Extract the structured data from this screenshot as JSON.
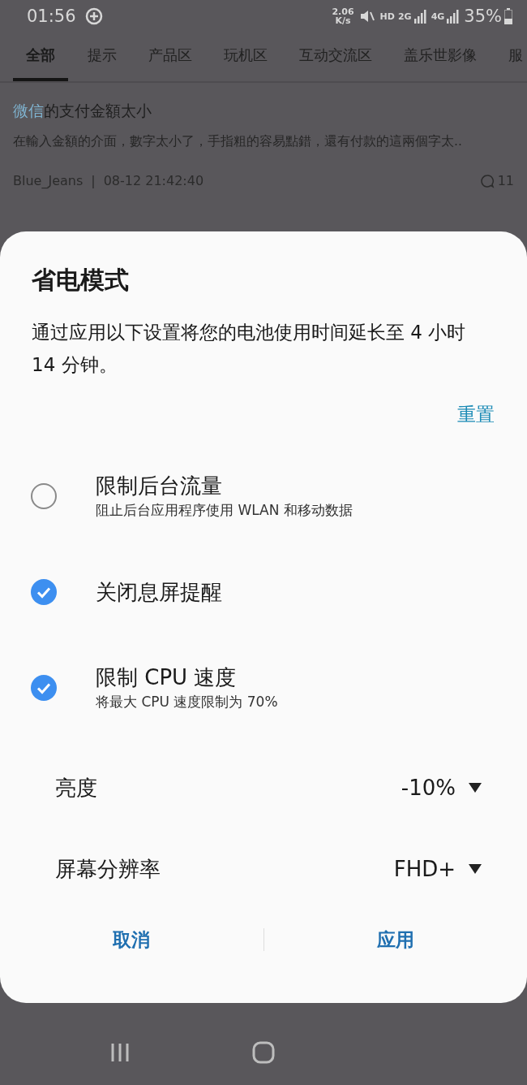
{
  "status_bar": {
    "time": "01:56",
    "net_speed": "2.06",
    "net_unit": "K/s",
    "hd": "HD",
    "sim1": "2G",
    "sim2": "4G",
    "battery": "35%"
  },
  "tabs": [
    {
      "label": "全部",
      "selected": true
    },
    {
      "label": "提示",
      "selected": false
    },
    {
      "label": "产品区",
      "selected": false
    },
    {
      "label": "玩机区",
      "selected": false
    },
    {
      "label": "互动交流区",
      "selected": false
    },
    {
      "label": "盖乐世影像",
      "selected": false
    },
    {
      "label": "服",
      "selected": false
    }
  ],
  "post": {
    "title_link": "微信",
    "title_rest": "的支付金額太小",
    "snippet": "在輸入金額的介面，數字太小了，手指粗的容易點錯，還有付款的這兩個字太..",
    "author": "Blue_Jeans",
    "separator": "|",
    "time": "08-12 21:42:40",
    "comments": "11"
  },
  "dialog": {
    "title": "省电模式",
    "description": "通过应用以下设置将您的电池使用时间延长至 4 小时 14 分钟。",
    "reset": "重置",
    "options": [
      {
        "kind": "checkbox",
        "label": "限制后台流量",
        "sub": "阻止后台应用程序使用 WLAN 和移动数据",
        "checked": false
      },
      {
        "kind": "checkbox",
        "label": "关闭息屏提醒",
        "checked": true
      },
      {
        "kind": "checkbox",
        "label": "限制 CPU 速度",
        "sub": "将最大 CPU 速度限制为 70%",
        "checked": true
      },
      {
        "kind": "dropdown",
        "label": "亮度",
        "value": "-10%"
      },
      {
        "kind": "dropdown",
        "label": "屏幕分辨率",
        "value": "FHD+"
      }
    ],
    "buttons": [
      "取消",
      "应用"
    ]
  }
}
